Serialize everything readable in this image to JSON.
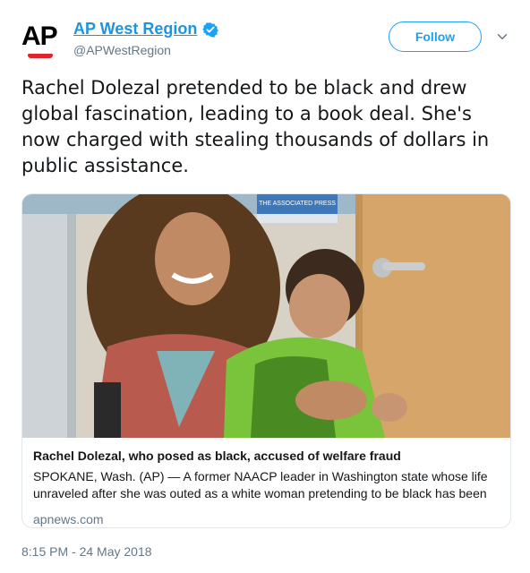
{
  "account": {
    "logo_text": "AP",
    "display_name": "AP West Region",
    "handle": "@APWestRegion",
    "verified": true
  },
  "header": {
    "follow_label": "Follow",
    "menu_icon": "chevron-down-icon"
  },
  "tweet": {
    "text": "Rachel Dolezal pretended to be black and drew global fascination, leading to a book deal. She's now charged with stealing thousands of dollars in public assistance.",
    "timestamp": "8:15 PM - 24 May 2018"
  },
  "card": {
    "image_label": "photo",
    "watermark": "THE ASSOCIATED PRESS",
    "title": "Rachel Dolezal, who posed as black, accused of welfare fraud",
    "description": "SPOKANE, Wash. (AP) — A former NAACP leader in Washington state whose life unraveled after she was outed as a white woman pretending to be black has been c...",
    "domain": "apnews.com"
  },
  "colors": {
    "accent": "#1da1f2",
    "link": "#1b95e0",
    "secondary_text": "#657786",
    "ap_red": "#e0222b"
  }
}
